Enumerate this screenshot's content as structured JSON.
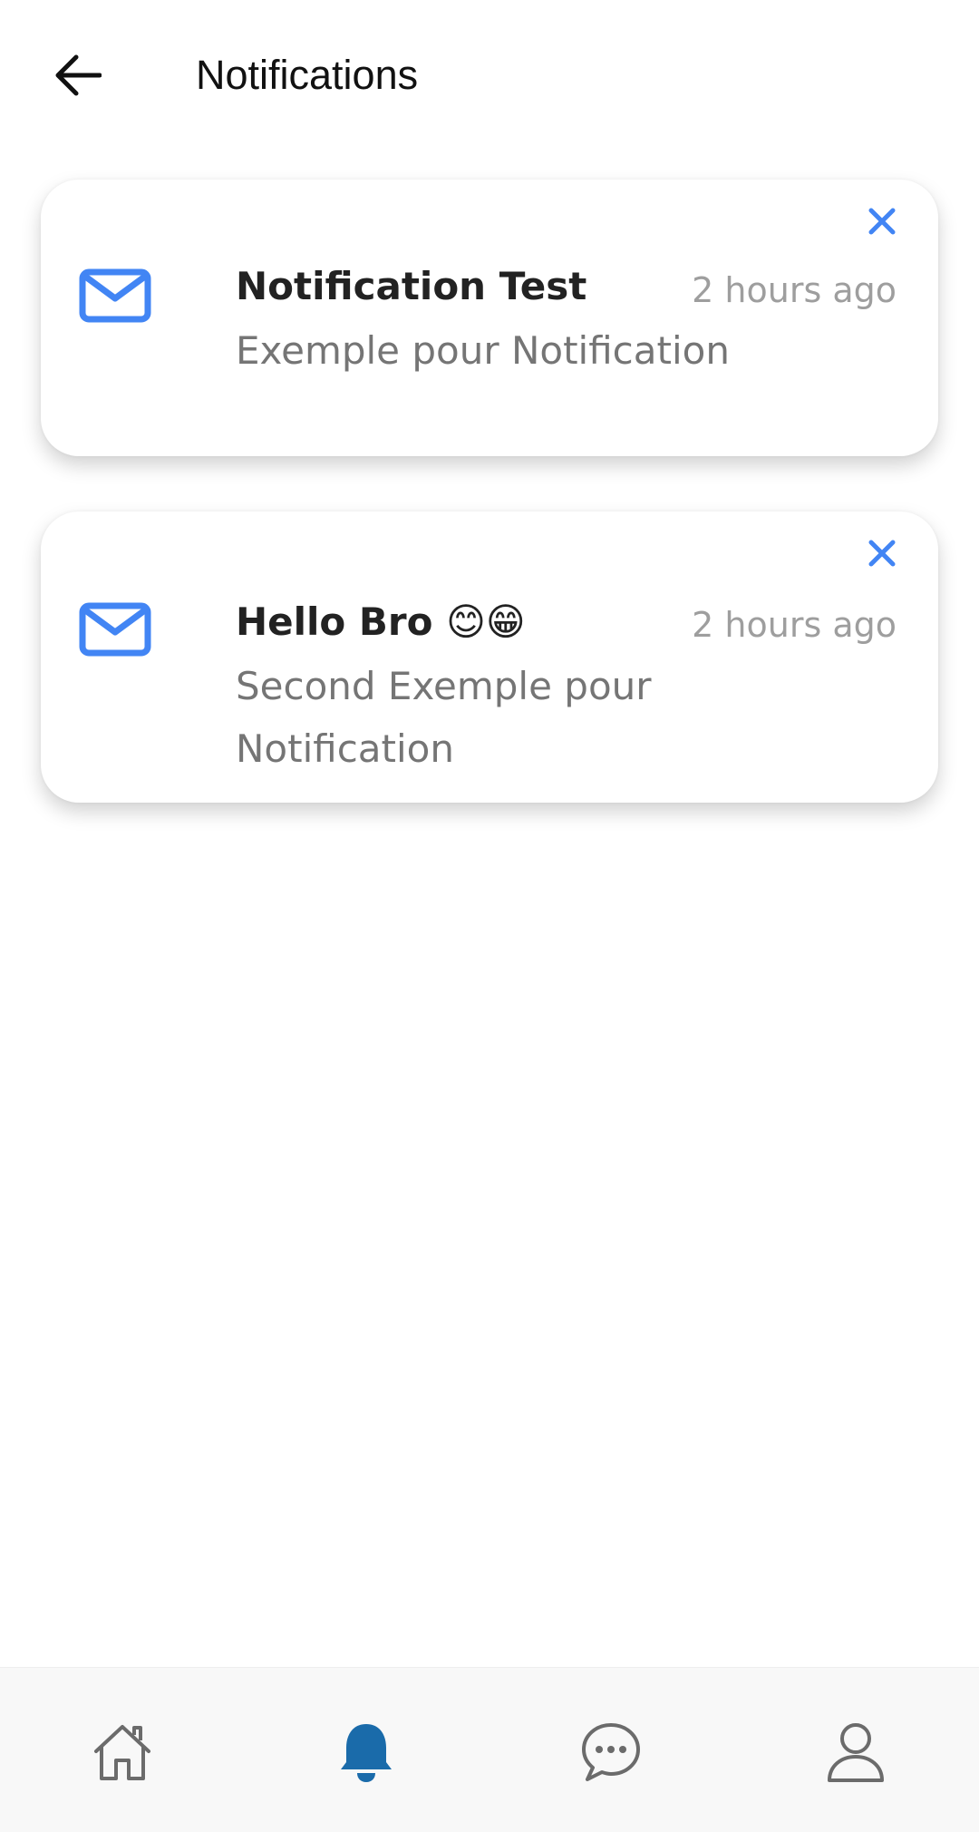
{
  "app_bar": {
    "title": "Notifications",
    "back_icon": "arrow-left-icon"
  },
  "notifications": [
    {
      "title": "Notification Test",
      "time": "2 hours ago",
      "body": "Exemple pour Notification",
      "icon": "mail-icon"
    },
    {
      "title": "Hello Bro 😊😁",
      "time": "2 hours ago",
      "body": "Second Exemple pour Notification",
      "icon": "mail-icon"
    }
  ],
  "bottom_nav": {
    "items": [
      {
        "icon": "home-icon",
        "active": false
      },
      {
        "icon": "bell-icon",
        "active": true
      },
      {
        "icon": "chat-icon",
        "active": false
      },
      {
        "icon": "person-icon",
        "active": false
      }
    ]
  },
  "colors": {
    "accent_blue": "#4285F4",
    "active_nav": "#1A6BAA",
    "inactive_nav": "#6B6B6B",
    "title_text": "#222222",
    "body_text": "#757575",
    "time_text": "#9E9E9E"
  }
}
